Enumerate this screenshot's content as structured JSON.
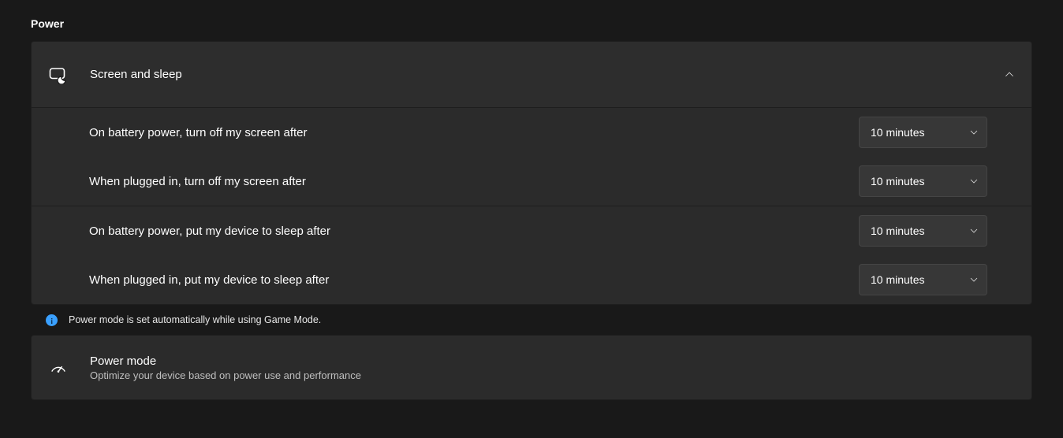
{
  "section_title": "Power",
  "screen_sleep": {
    "header": "Screen and sleep",
    "rows": [
      {
        "label": "On battery power, turn off my screen after",
        "value": "10 minutes"
      },
      {
        "label": "When plugged in, turn off my screen after",
        "value": "10 minutes"
      },
      {
        "label": "On battery power, put my device to sleep after",
        "value": "10 minutes"
      },
      {
        "label": "When plugged in, put my device to sleep after",
        "value": "10 minutes"
      }
    ]
  },
  "info_message": "Power mode is set automatically while using Game Mode.",
  "power_mode": {
    "title": "Power mode",
    "subtitle": "Optimize your device based on power use and performance"
  }
}
